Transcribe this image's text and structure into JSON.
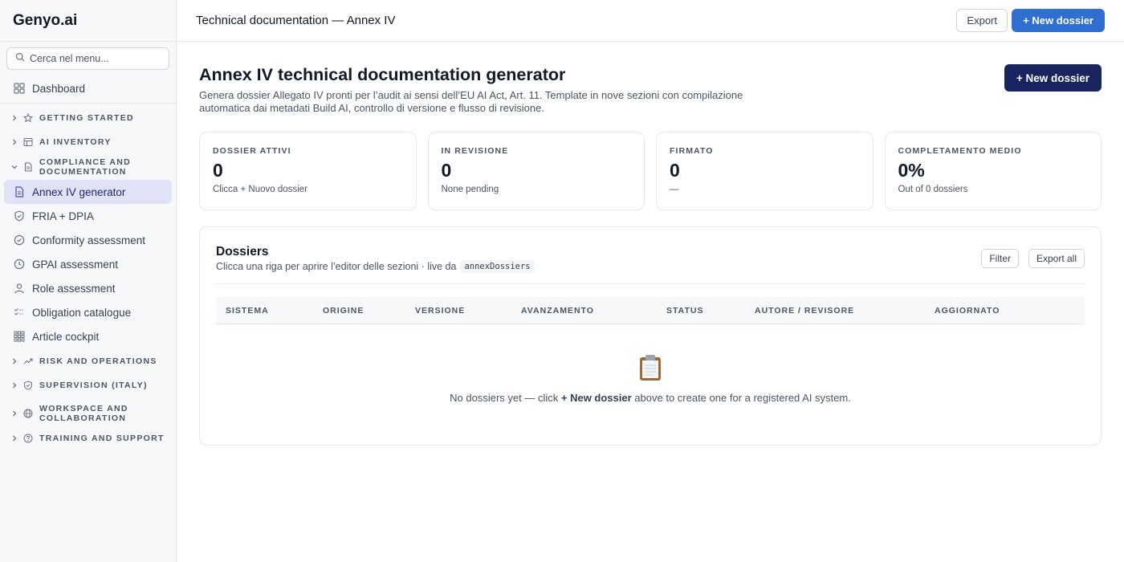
{
  "sidebar": {
    "brand": "Genyo.ai",
    "search_placeholder": "Cerca nel menu...",
    "dashboard": "Dashboard",
    "groups": {
      "getting_started": "GETTING STARTED",
      "ai_inventory": "AI INVENTORY",
      "compliance": "COMPLIANCE AND DOCUMENTATION",
      "risk": "RISK AND OPERATIONS",
      "supervision": "SUPERVISION (ITALY)",
      "workspace": "WORKSPACE AND COLLABORATION",
      "training": "TRAINING AND SUPPORT"
    },
    "items": {
      "annex": "Annex IV generator",
      "fria": "FRIA + DPIA",
      "conformity": "Conformity assessment",
      "gpai": "GPAI assessment",
      "role": "Role assessment",
      "obligation": "Obligation catalogue",
      "article": "Article cockpit"
    }
  },
  "topbar": {
    "title": "Technical documentation — Annex IV",
    "export_label": "Export",
    "new_label": "+ New dossier"
  },
  "main": {
    "title": "Annex IV technical documentation generator",
    "subtitle": "Genera dossier Allegato IV pronti per l’audit ai sensi dell’EU AI Act, Art. 11. Template in nove sezioni con compilazione automatica dai metadati Build AI, controllo di versione e flusso di revisione.",
    "new_label": "+ New dossier"
  },
  "stats": [
    {
      "label": "DOSSIER ATTIVI",
      "value": "0",
      "hint": "Clicca + Nuovo dossier"
    },
    {
      "label": "IN REVISIONE",
      "value": "0",
      "hint": "None pending"
    },
    {
      "label": "FIRMATO",
      "value": "0",
      "hint": "—"
    },
    {
      "label": "COMPLETAMENTO MEDIO",
      "value": "0%",
      "hint": "Out of 0 dossiers"
    }
  ],
  "dossiers": {
    "title": "Dossiers",
    "subtitle": "Clicca una riga per aprire l’editor delle sezioni · live da",
    "code": "annexDossiers",
    "filter_label": "Filter",
    "export_all_label": "Export all",
    "columns": [
      "SISTEMA",
      "ORIGINE",
      "VERSIONE",
      "AVANZAMENTO",
      "STATUS",
      "AUTORE / REVISORE",
      "AGGIORNATO"
    ],
    "empty": {
      "prefix": "No dossiers yet — click",
      "bold": "+ New dossier",
      "suffix": "above to create one for a registered AI system."
    }
  }
}
